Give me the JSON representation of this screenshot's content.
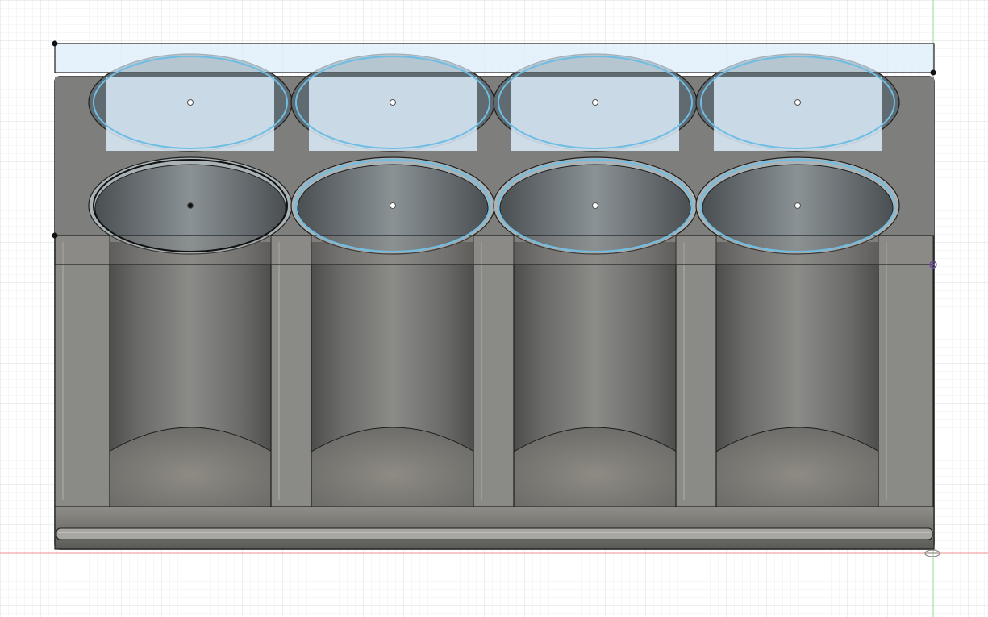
{
  "app": {
    "view": "cad-canvas",
    "background_color": "#ffffff",
    "grid_minor_color": "#eef0f2",
    "grid_major_color": "#d9dde1",
    "axis_x_color": "#f4a6a6",
    "axis_y_color": "#a8e0a8",
    "sketch_profile_color": "#6fbde3",
    "sketch_fill_color": "#dcecfa",
    "body_color": "#7b7b78",
    "edge_color": "#1e1e1e"
  },
  "model": {
    "body_name": "",
    "hole_count": 4,
    "selected_hole_index": 0,
    "icons": {
      "sketch_point": "circle-point-icon",
      "constraint": "constraint-icon",
      "origin": "origin-icon"
    }
  }
}
